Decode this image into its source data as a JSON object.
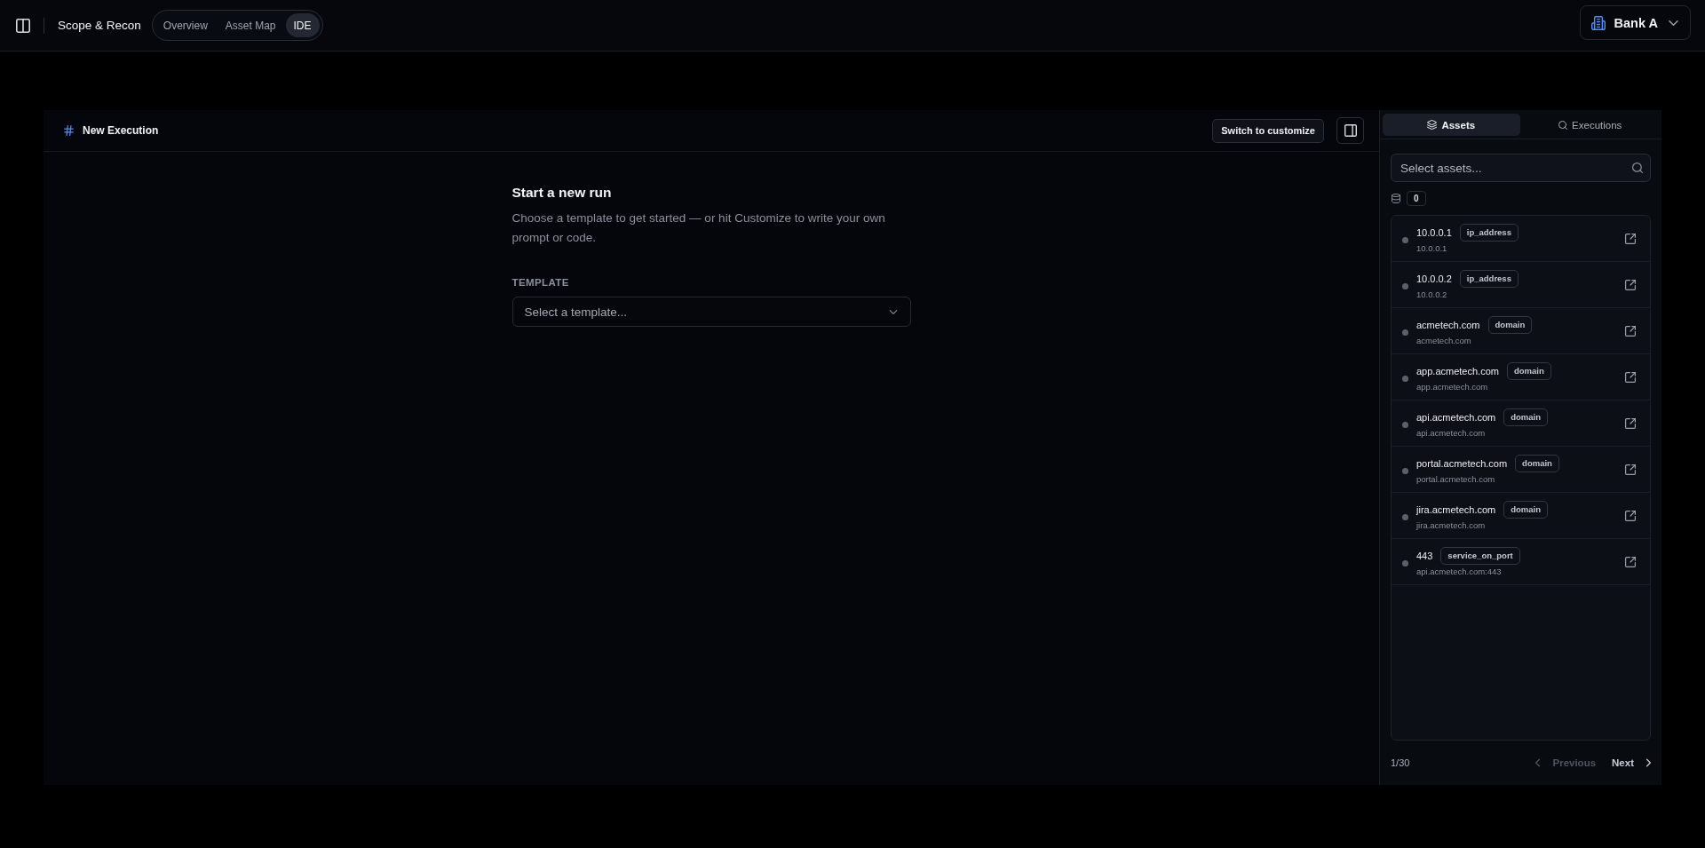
{
  "top_bar": {
    "title": "Scope & Recon",
    "tabs": [
      {
        "label": "Overview",
        "selected": false
      },
      {
        "label": "Asset Map",
        "selected": false
      },
      {
        "label": "IDE",
        "selected": true
      }
    ],
    "organization": "Bank A"
  },
  "editor": {
    "title": "New Execution",
    "switch_button": "Switch to customize",
    "heading": "Start a new run",
    "description": "Choose a template to get started — or hit Customize to write your own prompt or code.",
    "template_label": "TEMPLATE",
    "template_select": {
      "placeholder": "Select a template..."
    }
  },
  "side_panel": {
    "tabs": [
      {
        "label": "Assets",
        "kind": "assets",
        "selected": true
      },
      {
        "label": "Executions",
        "kind": "executions",
        "selected": false
      }
    ],
    "search": {
      "placeholder": "Select assets..."
    },
    "selected_count": "0",
    "assets": [
      {
        "name": "10.0.0.1",
        "type": "ip_address",
        "value": "10.0.0.1"
      },
      {
        "name": "10.0.0.2",
        "type": "ip_address",
        "value": "10.0.0.2"
      },
      {
        "name": "acmetech.com",
        "type": "domain",
        "value": "acmetech.com"
      },
      {
        "name": "app.acmetech.com",
        "type": "domain",
        "value": "app.acmetech.com"
      },
      {
        "name": "api.acmetech.com",
        "type": "domain",
        "value": "api.acmetech.com"
      },
      {
        "name": "portal.acmetech.com",
        "type": "domain",
        "value": "portal.acmetech.com"
      },
      {
        "name": "jira.acmetech.com",
        "type": "domain",
        "value": "jira.acmetech.com"
      },
      {
        "name": "443",
        "type": "service_on_port",
        "value": "api.acmetech.com:443"
      }
    ],
    "pagination": {
      "page": "1/30",
      "previous": {
        "label": "Previous",
        "disabled": true
      },
      "next": {
        "label": "Next",
        "disabled": false
      }
    }
  }
}
